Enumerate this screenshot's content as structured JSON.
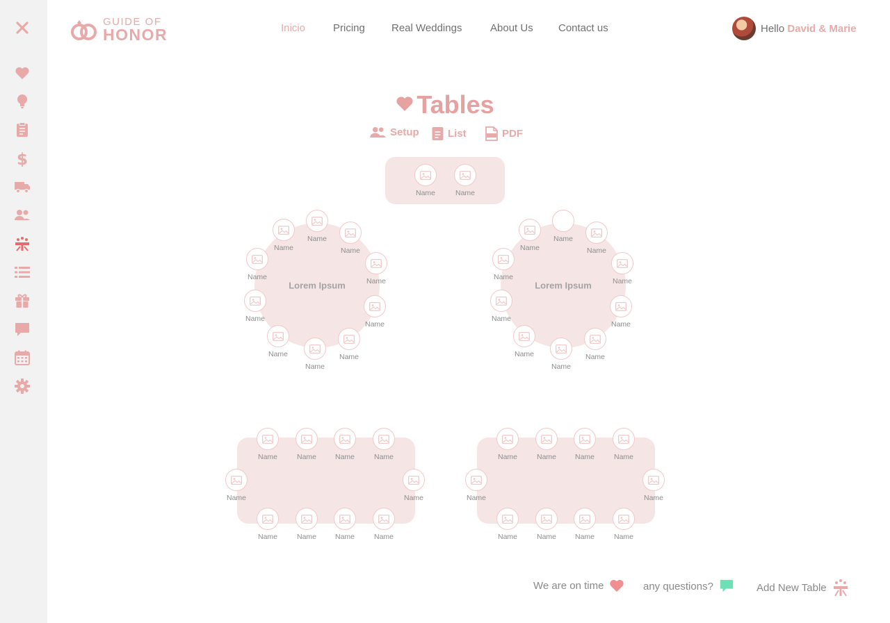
{
  "brand": {
    "top": "GUIDE OF",
    "bottom": "HONOR"
  },
  "nav": [
    "Inicio",
    "Pricing",
    "Real Weddings",
    "About Us",
    "Contact us"
  ],
  "user": {
    "greeting": "Hello",
    "names": "David & Marie"
  },
  "page": {
    "title": "Tables"
  },
  "actions": {
    "setup": "Setup",
    "list": "List",
    "pdf": "PDF"
  },
  "seat_label": "Name",
  "tables": {
    "round_1_name": "Lorem Ipsum",
    "round_2_name": "Lorem Ipsum"
  },
  "footer": {
    "on_time": "We are on time",
    "questions": "any questions?",
    "add_table": "Add New Table"
  },
  "sidebar_icons": [
    "close-icon",
    "heart-icon",
    "lightbulb-icon",
    "clipboard-icon",
    "dollar-icon",
    "truck-icon",
    "guests-icon",
    "table-icon",
    "list-icon",
    "gift-icon",
    "chat-icon",
    "calendar-icon",
    "gear-icon"
  ],
  "colors": {
    "accent": "#e8a9a9",
    "active_sidebar": "#e86a6a",
    "table_fill": "#f5e6e5",
    "chat_green": "#6fe0b5",
    "heart": "#f08f8f"
  }
}
